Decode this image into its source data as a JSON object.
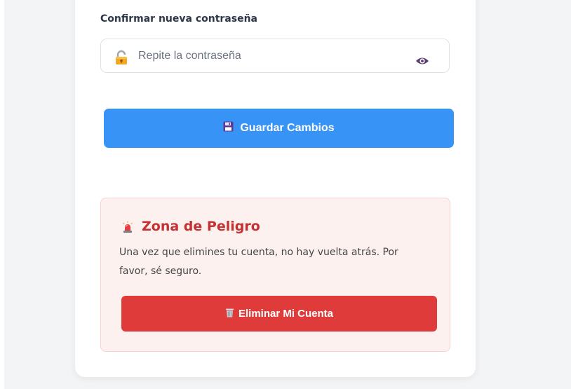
{
  "form": {
    "confirm_label": "Confirmar nueva contraseña",
    "confirm_placeholder": "Repite la contraseña",
    "save_label": "Guardar Cambios"
  },
  "danger_zone": {
    "title": "Zona de Peligro",
    "description": "Una vez que elimines tu cuenta, no hay vuelta atrás. Por favor, sé seguro.",
    "delete_label": "Eliminar Mi Cuenta"
  },
  "colors": {
    "primary": "#3893f6",
    "danger": "#e03b3b",
    "danger_title": "#c53030",
    "danger_bg": "#fdf1f0"
  },
  "icons": {
    "field": "lock-icon",
    "visibility": "eye-icon",
    "save": "floppy-disk-icon",
    "danger": "siren-icon",
    "delete": "trash-icon"
  }
}
